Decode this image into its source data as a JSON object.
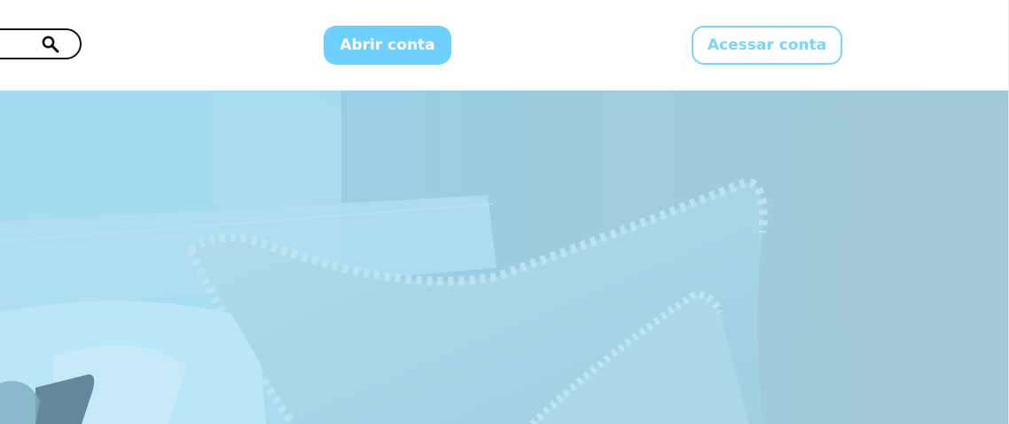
{
  "header": {
    "open_account_label": "Abrir conta",
    "access_account_label": "Acessar conta",
    "search_icon": "search-icon"
  },
  "hero": {
    "image": "bedroom-pillows-photo"
  },
  "colors": {
    "accent": "#6fd0fb",
    "outline": "#7cd4fb",
    "border_dark": "#111111",
    "hero_tint": "#8fd4ef"
  }
}
